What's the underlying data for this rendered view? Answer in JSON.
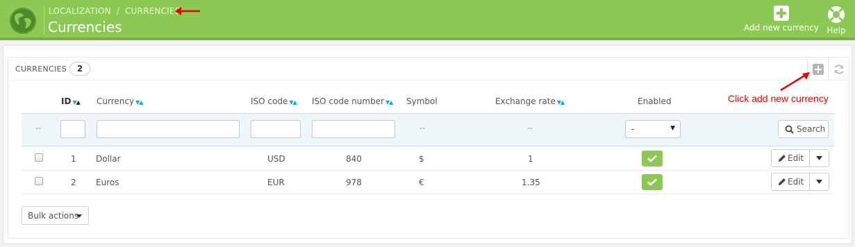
{
  "header": {
    "breadcrumb": [
      "LOCALIZATION",
      "CURRENCIES"
    ],
    "breadcrumb_sep": "/",
    "title": "Currencies",
    "toolbar": [
      {
        "label": "Add new currency",
        "icon": "plus-square-icon"
      },
      {
        "label": "Help",
        "icon": "lifebuoy-icon"
      }
    ],
    "colors": {
      "bar": "#8bc954",
      "bar_border": "#72b340"
    }
  },
  "panel": {
    "title": "CURRENCIES",
    "count": "2",
    "icons": [
      "add-icon",
      "refresh-icon"
    ]
  },
  "annotation": {
    "note": "Click add new currency",
    "color": "#ee0000"
  },
  "table": {
    "columns": [
      "ID",
      "Currency",
      "ISO code",
      "ISO code number",
      "Symbol",
      "Exchange rate",
      "Enabled"
    ],
    "filters": {
      "dash": "--",
      "enabled_value": "-",
      "search_label": "Search"
    },
    "rows": [
      {
        "id": "1",
        "currency": "Dollar",
        "iso_code": "USD",
        "iso_number": "840",
        "symbol": "$",
        "rate": "1",
        "enabled": true
      },
      {
        "id": "2",
        "currency": "Euros",
        "iso_code": "EUR",
        "iso_number": "978",
        "symbol": "€",
        "rate": "1.35",
        "enabled": true
      }
    ],
    "edit_label": "Edit"
  },
  "bulk_actions_label": "Bulk actions"
}
